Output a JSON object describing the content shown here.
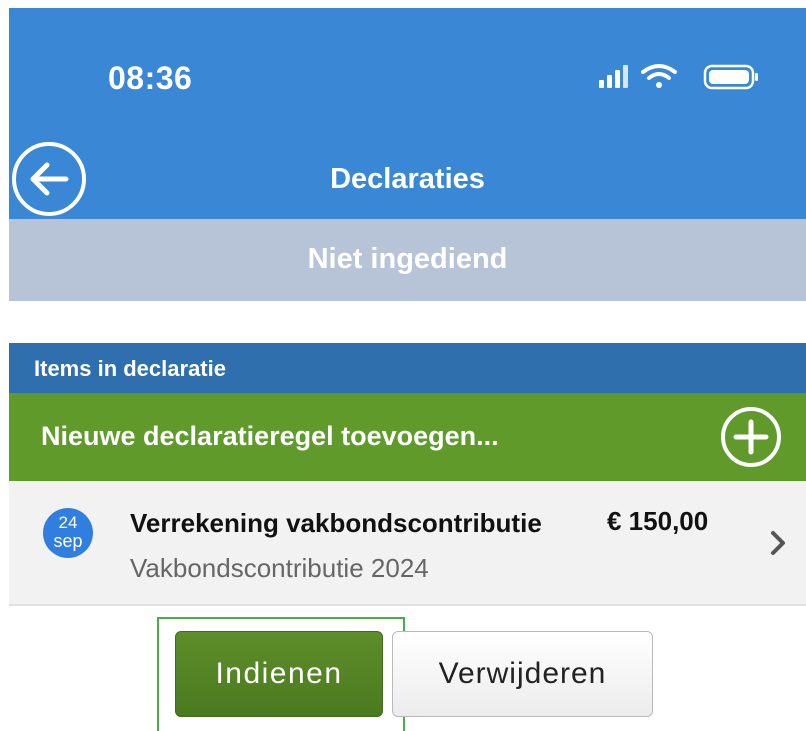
{
  "status_bar": {
    "time": "08:36",
    "icons": [
      "signal-icon",
      "wifi-icon",
      "battery-icon"
    ]
  },
  "header": {
    "title": "Declaraties",
    "back_icon": "back-arrow-icon"
  },
  "subheader": {
    "status": "Niet ingediend"
  },
  "section": {
    "title": "Items in declaratie"
  },
  "add_row": {
    "label": "Nieuwe declaratieregel toevoegen...",
    "icon": "plus-circle-icon"
  },
  "items": [
    {
      "date_day": "24",
      "date_month": "sep",
      "title": "Verrekening vakbondscontributie",
      "amount": "€ 150,00",
      "subtitle": "Vakbondscontributie 2024"
    }
  ],
  "actions": {
    "submit_label": "Indienen",
    "delete_label": "Verwijderen"
  },
  "colors": {
    "header": "#3a87d6",
    "subheader": "#b7c4d8",
    "section_bar": "#2f6fad",
    "add_row": "#5f9a2b",
    "submit_button": "#4f7f22",
    "date_badge": "#2f7ee0",
    "highlight": "#46b046"
  }
}
